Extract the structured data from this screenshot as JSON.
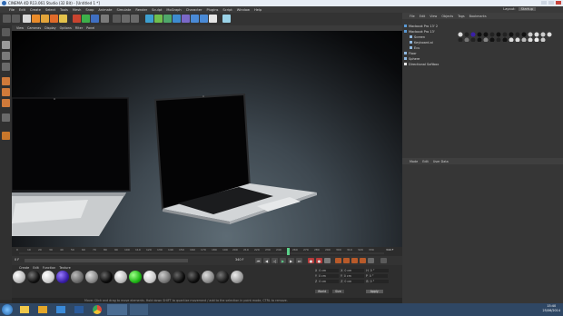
{
  "window": {
    "title": "CINEMA 4D R13.061 Studio (32 Bit) - [Untitled 1 *]"
  },
  "menu": {
    "items": [
      "File",
      "Edit",
      "Create",
      "Select",
      "Tools",
      "Mesh",
      "Snap",
      "Animate",
      "Simulate",
      "Render",
      "Sculpt",
      "MoGraph",
      "Character",
      "Plugins",
      "Script",
      "Window",
      "Help"
    ],
    "layout_label": "Layout:",
    "layout_value": "Startup"
  },
  "viewport": {
    "menu": [
      "View",
      "Cameras",
      "Display",
      "Options",
      "Filter",
      "Panel"
    ]
  },
  "timeline": {
    "ticks": [
      "0",
      "10",
      "20",
      "30",
      "40",
      "50",
      "60",
      "70",
      "80",
      "90",
      "100",
      "110",
      "120",
      "130",
      "140",
      "150",
      "160",
      "170",
      "180",
      "190",
      "200",
      "210",
      "220",
      "230",
      "240",
      "250",
      "260",
      "270",
      "280",
      "290",
      "300",
      "310",
      "320",
      "330",
      "340"
    ],
    "end_label": "340 F",
    "current_frame": "0 F",
    "end_frame": "340 F"
  },
  "material_manager": {
    "menu": [
      "Create",
      "Edit",
      "Function",
      "Texture"
    ]
  },
  "coordinates": {
    "rows": [
      {
        "axis": "X",
        "val": "0 cm",
        "axis2": "X",
        "val2": "0 cm",
        "axis3": "H",
        "val3": "0 °"
      },
      {
        "axis": "Y",
        "val": "0 cm",
        "axis2": "Y",
        "val2": "0 cm",
        "axis3": "P",
        "val3": "0 °"
      },
      {
        "axis": "Z",
        "val": "0 cm",
        "axis2": "Z",
        "val2": "0 cm",
        "axis3": "B",
        "val3": "0 °"
      }
    ],
    "mode": "World",
    "size_mode": "Size",
    "apply": "Apply"
  },
  "status": {
    "text": "Move: Click and drag to move elements. Hold down SHIFT to quantize movement / add to the selection in point mode, CTRL to remove."
  },
  "object_manager": {
    "menu": [
      "File",
      "Edit",
      "View",
      "Objects",
      "Tags",
      "Bookmarks"
    ],
    "objects": [
      {
        "name": "Macbook Pro 13' 2",
        "indent": 0
      },
      {
        "name": "Macbook Pro 13'",
        "indent": 0
      },
      {
        "name": "Screen",
        "indent": 1
      },
      {
        "name": "Keyboard.ai",
        "indent": 1
      },
      {
        "name": "Ecu",
        "indent": 1
      },
      {
        "name": "Floor",
        "indent": 0
      },
      {
        "name": "Sphere",
        "indent": 0
      },
      {
        "name": "Directional Softbox",
        "indent": 0
      }
    ]
  },
  "attribute_manager": {
    "menu": [
      "Mode",
      "Edit",
      "User Data"
    ]
  },
  "taskbar": {
    "time": "15:40",
    "date": "25/06/2014"
  },
  "colors": {
    "titlebar": "#e8eef6",
    "panel": "#363636",
    "viewport_floor": "#5d6b74",
    "playhead": "#5bd08a",
    "taskbar": "#2f4764"
  }
}
